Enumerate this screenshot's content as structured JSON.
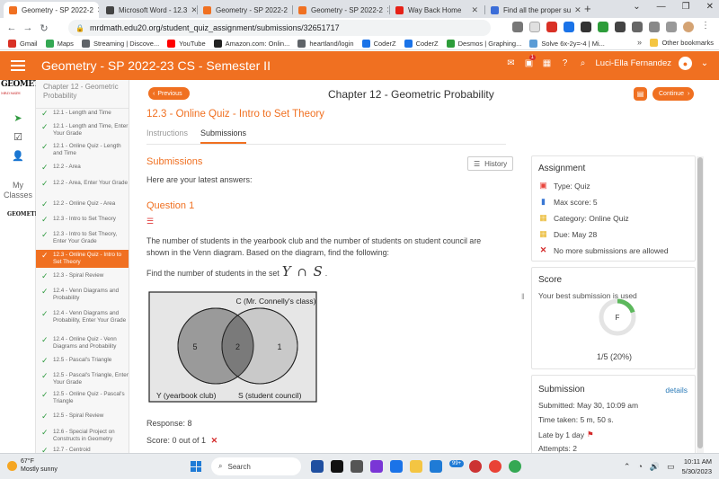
{
  "browser": {
    "tabs": [
      {
        "title": "Geometry - SP 2022-2",
        "favicon_color": "#f07021",
        "active": true
      },
      {
        "title": "Microsoft Word - 12.3",
        "favicon_color": "#444444",
        "active": false
      },
      {
        "title": "Geometry - SP 2022-2",
        "favicon_color": "#f07021",
        "active": false
      },
      {
        "title": "Geometry - SP 2022-2",
        "favicon_color": "#f07021",
        "active": false
      },
      {
        "title": "Way Back Home",
        "favicon_color": "#e62117",
        "active": false
      },
      {
        "title": "Find all the proper su",
        "favicon_color": "#3b6dd8",
        "active": false
      }
    ],
    "new_tab": "+",
    "url": "mrdmath.edu20.org/student_quiz_assignment/submissions/32651717",
    "bookmarks": [
      "Gmail",
      "Maps",
      "Streaming | Discove...",
      "YouTube",
      "Amazon.com: Onlin...",
      "heartland/login",
      "CoderZ",
      "CoderZ",
      "Desmos | Graphing...",
      "Solve 6x-2y=-4 | Mi..."
    ],
    "bookmark_colors": [
      "#d93025",
      "#34a853",
      "#5f6368",
      "#ff0000",
      "#222222",
      "#5f6368",
      "#1a73e8",
      "#1a73e8",
      "#2d9d3a",
      "#5a9bd5"
    ],
    "bookmarks_more": "»",
    "other_bookmarks": "Other bookmarks"
  },
  "app": {
    "course_title": "Geometry - SP 2022-23 CS - Semester II",
    "notification_count": "1",
    "user_name": "Luci-Ella Fernandez",
    "accent_color": "#f07021"
  },
  "rail": {
    "logo": "GEOMETRY",
    "logo_sub": "MR.D MATH",
    "my_classes": "My Classes",
    "logo_small": "GEOMETRY"
  },
  "sidebar": {
    "heading": "Chapter 12 - Geometric Probability",
    "items": [
      {
        "label": "12.1 - Length and Time",
        "active": false
      },
      {
        "label": "12.1 - Length and Time, Enter Your Grade",
        "active": false
      },
      {
        "label": "12.1 - Online Quiz - Length and Time",
        "active": false
      },
      {
        "label": "12.2 - Area",
        "active": false
      },
      {
        "label": "12.2 - Area, Enter Your Grade",
        "active": false
      },
      {
        "label": "12.2 - Online Quiz - Area",
        "active": false
      },
      {
        "label": "12.3 - Intro to Set Theory",
        "active": false
      },
      {
        "label": "12.3 - Intro to Set Theory, Enter Your Grade",
        "active": false
      },
      {
        "label": "12.3 - Online Quiz - Intro to Set Theory",
        "active": true
      },
      {
        "label": "12.3 - Spiral Review",
        "active": false
      },
      {
        "label": "12.4 - Venn Diagrams and Probability",
        "active": false
      },
      {
        "label": "12.4 - Venn Diagrams and Probability, Enter Your Grade",
        "active": false
      },
      {
        "label": "12.4 - Online Quiz - Venn Diagrams and Probability",
        "active": false
      },
      {
        "label": "12.5 - Pascal's Triangle",
        "active": false
      },
      {
        "label": "12.5 - Pascal's Triangle, Enter Your Grade",
        "active": false
      },
      {
        "label": "12.5 - Online Quiz - Pascal's Triangle",
        "active": false
      },
      {
        "label": "12.5 - Spiral Review",
        "active": false
      },
      {
        "label": "12.6 - Special Project on Constructs in Geometry",
        "active": false
      },
      {
        "label": "12.7 - Centroid",
        "active": false
      }
    ]
  },
  "main": {
    "prev_label": "Previous",
    "next_label": "Continue",
    "chapter_title": "Chapter 12 - Geometric Probability",
    "quiz_title": "12.3 - Online Quiz - Intro to Set Theory",
    "tabs": [
      "Instructions",
      "Submissions"
    ],
    "section_title": "Submissions",
    "history_label": "History",
    "latest_text": "Here are your latest answers:",
    "question_title": "Question 1",
    "question_text": "The number of students in the yearbook club and the number of students on student council are shown in the Venn diagram. Based on the diagram, find the following:",
    "find_text": "Find the number of students in the set",
    "set_left": "Y",
    "set_op": "∩",
    "set_right": "S",
    "set_end": ".",
    "venn": {
      "universe_label": "C (Mr. Connelly's class)",
      "left_label": "Y (yearbook club)",
      "right_label": "S (student council)",
      "only_left": "5",
      "both": "2",
      "only_right": "1"
    },
    "response_label": "Response:",
    "response_value": "8",
    "score_label": "Score: 0 out of 1"
  },
  "assignment": {
    "title": "Assignment",
    "type": "Type: Quiz",
    "max_score": "Max score: 5",
    "category": "Category: Online Quiz",
    "due": "Due: May 28",
    "no_more": "No more submissions are allowed"
  },
  "score_card": {
    "title": "Score",
    "best_text": "Your best submission is used",
    "grade": "F",
    "fraction": 0.2,
    "summary": "1/5 (20%)"
  },
  "submission_card": {
    "title": "Submission",
    "details_link": "details",
    "submitted": "Submitted: May 30, 10:09 am",
    "time_taken": "Time taken: 5 m, 50 s.",
    "late": "Late by 1 day",
    "attempts": "Attempts: 2"
  },
  "taskbar": {
    "temp": "67°F",
    "weather": "Mostly sunny",
    "search": "Search",
    "badge": "99+",
    "time": "10:11 AM",
    "date": "5/30/2023"
  }
}
